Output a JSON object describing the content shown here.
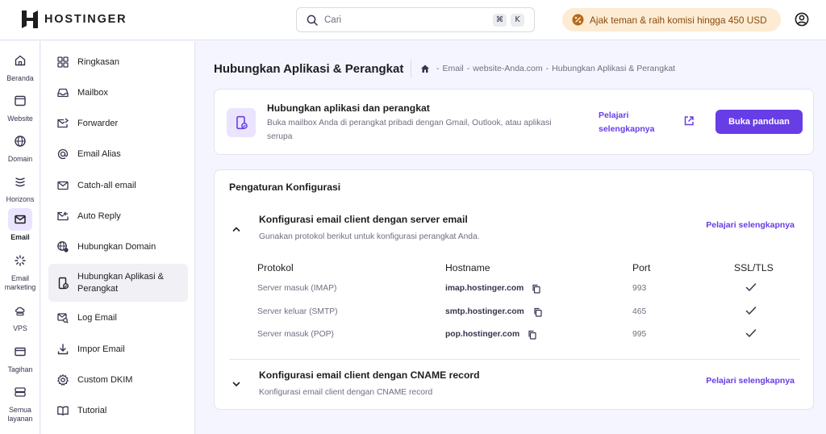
{
  "brand": {
    "name": "HOSTINGER"
  },
  "search": {
    "placeholder": "Cari",
    "shortcut_keys": [
      "⌘",
      "K"
    ]
  },
  "promo": {
    "text": "Ajak teman & raih komisi hingga 450 USD"
  },
  "rail": {
    "items": [
      {
        "label": "Beranda",
        "icon": "home-icon"
      },
      {
        "label": "Website",
        "icon": "browser-icon"
      },
      {
        "label": "Domain",
        "icon": "globe-icon"
      },
      {
        "label": "Horizons",
        "icon": "horizons-icon"
      },
      {
        "label": "Email",
        "icon": "mail-icon",
        "active": true
      },
      {
        "label": "Email marketing",
        "icon": "sparkle-icon"
      },
      {
        "label": "VPS",
        "icon": "cloud-server-icon"
      },
      {
        "label": "Tagihan",
        "icon": "credit-card-icon"
      },
      {
        "label": "Semua layanan",
        "icon": "database-icon"
      }
    ]
  },
  "subnav": {
    "items": [
      {
        "label": "Ringkasan",
        "icon": "dashboard-icon"
      },
      {
        "label": "Mailbox",
        "icon": "inbox-icon"
      },
      {
        "label": "Forwarder",
        "icon": "forward-mail-icon"
      },
      {
        "label": "Email Alias",
        "icon": "at-sign-icon"
      },
      {
        "label": "Catch-all email",
        "icon": "envelope-icon"
      },
      {
        "label": "Auto Reply",
        "icon": "auto-reply-icon"
      },
      {
        "label": "Hubungkan Domain",
        "icon": "globe-link-icon"
      },
      {
        "label": "Hubungkan Aplikasi & Perangkat",
        "icon": "device-link-icon",
        "active": true
      },
      {
        "label": "Log Email",
        "icon": "log-search-icon"
      },
      {
        "label": "Impor Email",
        "icon": "import-icon"
      },
      {
        "label": "Custom DKIM",
        "icon": "gear-icon"
      },
      {
        "label": "Tutorial",
        "icon": "book-icon"
      }
    ]
  },
  "page": {
    "title": "Hubungkan Aplikasi & Perangkat",
    "breadcrumb": [
      "Email",
      "website-Anda.com",
      "Hubungkan Aplikasi & Perangkat"
    ]
  },
  "feature": {
    "title": "Hubungkan aplikasi dan perangkat",
    "description": "Buka mailbox Anda di perangkat pribadi dengan Gmail, Outlook, atau aplikasi serupa",
    "learn_more": "Pelajari selengkapnya",
    "button": "Buka panduan"
  },
  "config": {
    "title": "Pengaturan Konfigurasi",
    "sections": [
      {
        "title": "Konfigurasi email client dengan server email",
        "description": "Gunakan protokol berikut untuk konfigurasi perangkat Anda.",
        "learn_more": "Pelajari selengkapnya",
        "expanded": true
      },
      {
        "title": "Konfigurasi email client dengan CNAME record",
        "description": "Konfigurasi email client dengan CNAME record",
        "learn_more": "Pelajari selengkapnya",
        "expanded": false
      }
    ],
    "table": {
      "headers": [
        "Protokol",
        "Hostname",
        "Port",
        "SSL/TLS"
      ],
      "rows": [
        {
          "protocol": "Server masuk (IMAP)",
          "hostname": "imap.hostinger.com",
          "port": "993",
          "ssl": true
        },
        {
          "protocol": "Server keluar (SMTP)",
          "hostname": "smtp.hostinger.com",
          "port": "465",
          "ssl": true
        },
        {
          "protocol": "Server masuk (POP)",
          "hostname": "pop.hostinger.com",
          "port": "995",
          "ssl": true
        }
      ]
    }
  },
  "colors": {
    "accent": "#673de6",
    "accent_light": "#ebe4ff",
    "text_dark": "#1d1e20",
    "text_muted": "#6d7081",
    "background": "#f4f5ff",
    "promo_bg": "#fdecd3"
  }
}
